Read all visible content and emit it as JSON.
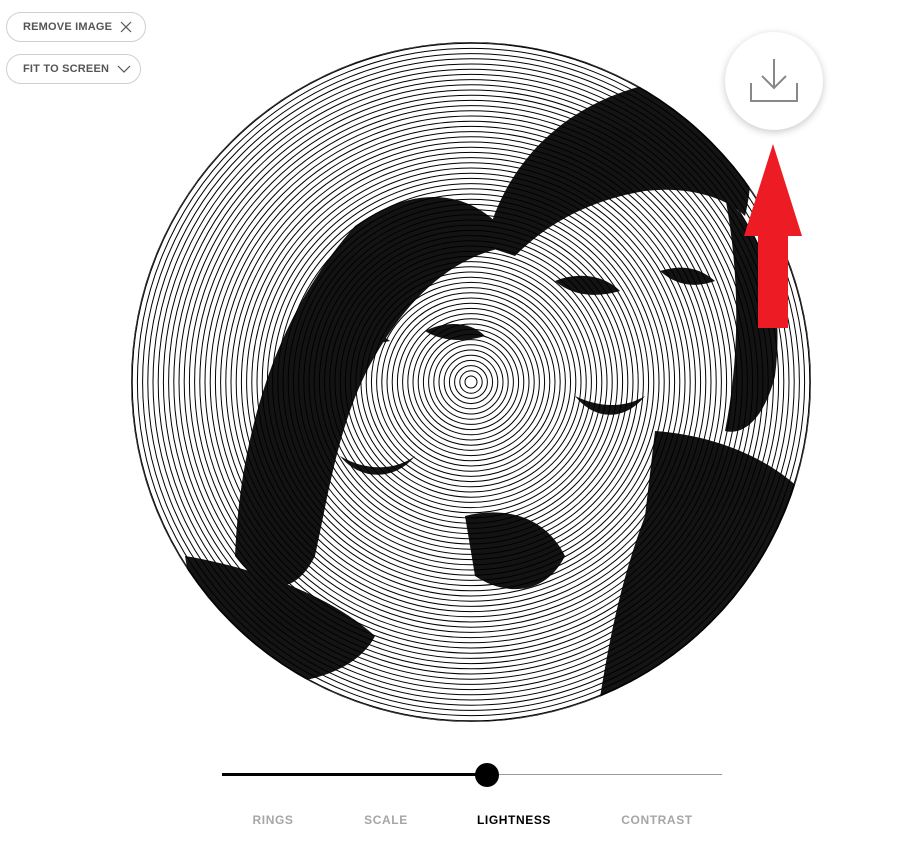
{
  "toolbar": {
    "remove_image_label": "REMOVE IMAGE",
    "remove_icon": "close-icon",
    "fit_to_screen_label": "FIT TO SCREEN",
    "fit_icon": "chevron-down-icon"
  },
  "download": {
    "icon": "download-icon"
  },
  "annotation": {
    "icon": "red-up-arrow",
    "color": "#ed1c24"
  },
  "slider": {
    "value": 0.53
  },
  "tabs": [
    {
      "label": "RINGS",
      "active": false
    },
    {
      "label": "SCALE",
      "active": false
    },
    {
      "label": "LIGHTNESS",
      "active": true
    },
    {
      "label": "CONTRAST",
      "active": false
    }
  ],
  "colors": {
    "ink": "#000000",
    "muted_tab": "#a6a6a6",
    "pill_border": "#cfcfcf"
  }
}
